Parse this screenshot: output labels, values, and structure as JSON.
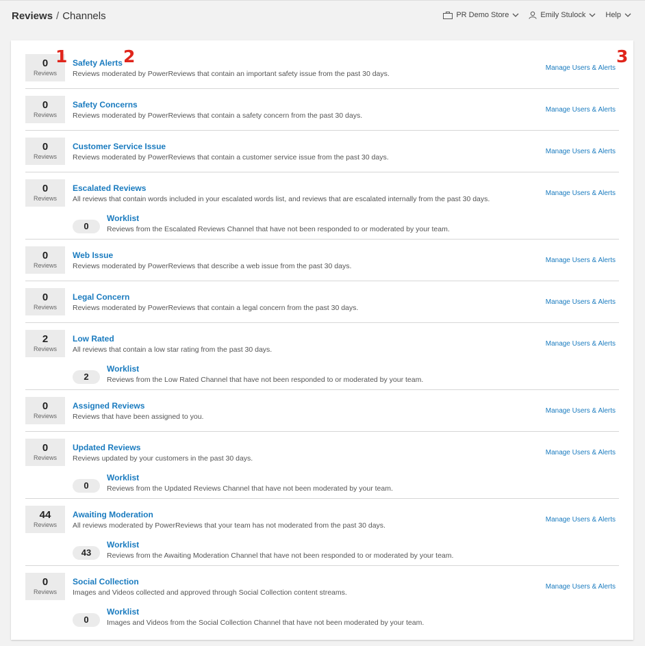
{
  "header": {
    "breadcrumb_root": "Reviews",
    "breadcrumb_sep": "/",
    "breadcrumb_current": "Channels",
    "store": "PR Demo Store",
    "user": "Emily Stulock",
    "help": "Help",
    "icons": [
      "store-icon",
      "user-icon",
      "chevron-down-icon"
    ]
  },
  "colors": {
    "link": "#1a7bbf",
    "marker": "#e0251b",
    "count_bg": "#ebebeb"
  },
  "count_label": "Reviews",
  "manage_label": "Manage Users & Alerts",
  "worklist_label": "Worklist",
  "markers": [
    "1",
    "2",
    "3"
  ],
  "channels": [
    {
      "count": "0",
      "title": "Safety Alerts",
      "desc": "Reviews moderated by PowerReviews that contain an important safety issue from the past 30 days."
    },
    {
      "count": "0",
      "title": "Safety Concerns",
      "desc": "Reviews moderated by PowerReviews that contain a safety concern from the past 30 days."
    },
    {
      "count": "0",
      "title": "Customer Service Issue",
      "desc": "Reviews moderated by PowerReviews that contain a customer service issue from the past 30 days."
    },
    {
      "count": "0",
      "title": "Escalated Reviews",
      "desc": "All reviews that contain words included in your escalated words list, and reviews that are escalated internally from the past 30 days.",
      "worklist": {
        "count": "0",
        "desc": "Reviews from the Escalated Reviews Channel that have not been responded to or moderated by your team."
      }
    },
    {
      "count": "0",
      "title": "Web Issue",
      "desc": "Reviews moderated by PowerReviews that describe a web issue from the past 30 days."
    },
    {
      "count": "0",
      "title": "Legal Concern",
      "desc": "Reviews moderated by PowerReviews that contain a legal concern from the past 30 days."
    },
    {
      "count": "2",
      "title": "Low Rated",
      "desc": "All reviews that contain a low star rating from the past 30 days.",
      "worklist": {
        "count": "2",
        "desc": "Reviews from the Low Rated Channel that have not been responded to or moderated by your team."
      }
    },
    {
      "count": "0",
      "title": "Assigned Reviews",
      "desc": "Reviews that have been assigned to you."
    },
    {
      "count": "0",
      "title": "Updated Reviews",
      "desc": "Reviews updated by your customers in the past 30 days.",
      "worklist": {
        "count": "0",
        "desc": "Reviews from the Updated Reviews Channel that have not been moderated by your team."
      }
    },
    {
      "count": "44",
      "title": "Awaiting Moderation",
      "desc": "All reviews moderated by PowerReviews that your team has not moderated from the past 30 days.",
      "worklist": {
        "count": "43",
        "desc": "Reviews from the Awaiting Moderation Channel that have not been responded to or moderated by your team."
      }
    },
    {
      "count": "0",
      "title": "Social Collection",
      "desc": "Images and Videos collected and approved through Social Collection content streams.",
      "worklist": {
        "count": "0",
        "desc": "Images and Videos from the Social Collection Channel that have not been moderated by your team."
      }
    }
  ]
}
